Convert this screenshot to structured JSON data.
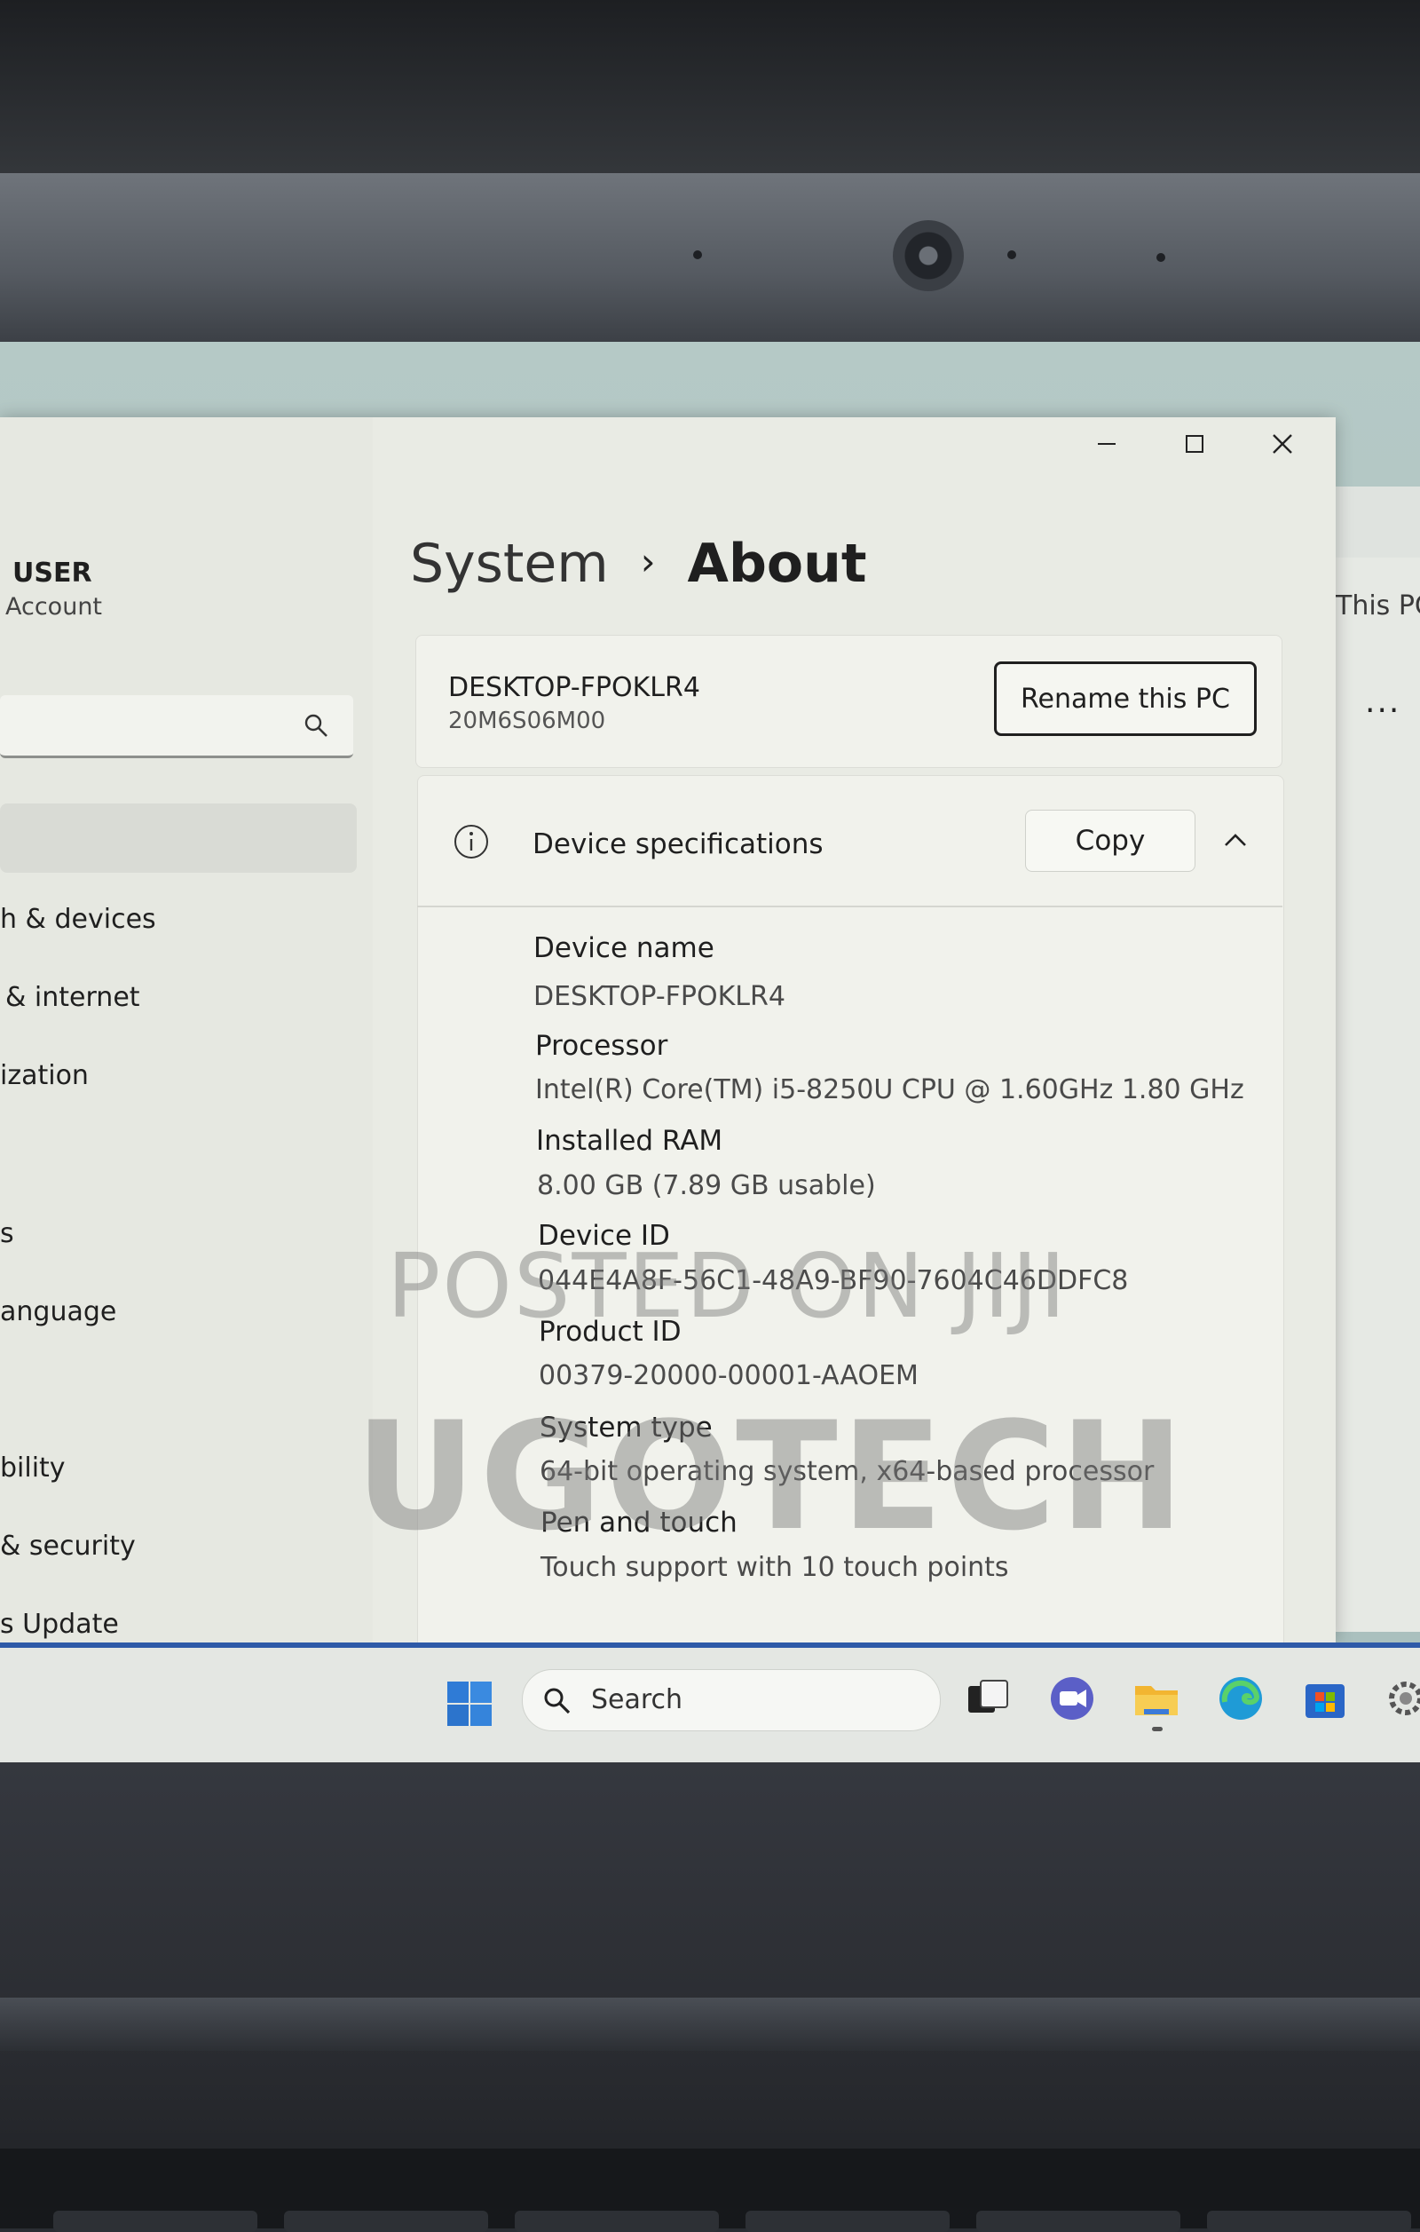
{
  "nav": {
    "user_name": "USER",
    "user_sub": "Account",
    "items": [
      {
        "label": "h & devices"
      },
      {
        "label": "& internet"
      },
      {
        "label": "ization"
      },
      {
        "label": "s"
      },
      {
        "label": "anguage"
      },
      {
        "label": "bility"
      },
      {
        "label": "& security"
      },
      {
        "label": "s Update"
      }
    ]
  },
  "breadcrumb": {
    "parent": "System",
    "separator": "›",
    "current": "About"
  },
  "pc": {
    "name": "DESKTOP-FPOKLR4",
    "model": "20M6S06M00",
    "rename_label": "Rename this PC"
  },
  "specs": {
    "header": "Device specifications",
    "copy_label": "Copy",
    "rows": [
      {
        "label": "Device name",
        "value": "DESKTOP-FPOKLR4"
      },
      {
        "label": "Processor",
        "value": "Intel(R) Core(TM) i5-8250U CPU @ 1.60GHz   1.80 GHz"
      },
      {
        "label": "Installed RAM",
        "value": "8.00 GB (7.89 GB usable)"
      },
      {
        "label": "Device ID",
        "value": "044E4A8F-56C1-48A9-BF90-7604C46DDFC8"
      },
      {
        "label": "Product ID",
        "value": "00379-20000-00001-AAOEM"
      },
      {
        "label": "System type",
        "value": "64-bit operating system, x64-based processor"
      },
      {
        "label": "Pen and touch",
        "value": "Touch support with 10 touch points"
      }
    ]
  },
  "background_window": {
    "title": "This PC",
    "more": "..."
  },
  "watermark": {
    "line1": "POSTED ON JIJI",
    "line2": "UGOTECH"
  },
  "taskbar": {
    "search_label": "Search"
  },
  "colors": {
    "taskbar_accent": "#2e5aa8",
    "window_bg": "#e9ebe4"
  }
}
